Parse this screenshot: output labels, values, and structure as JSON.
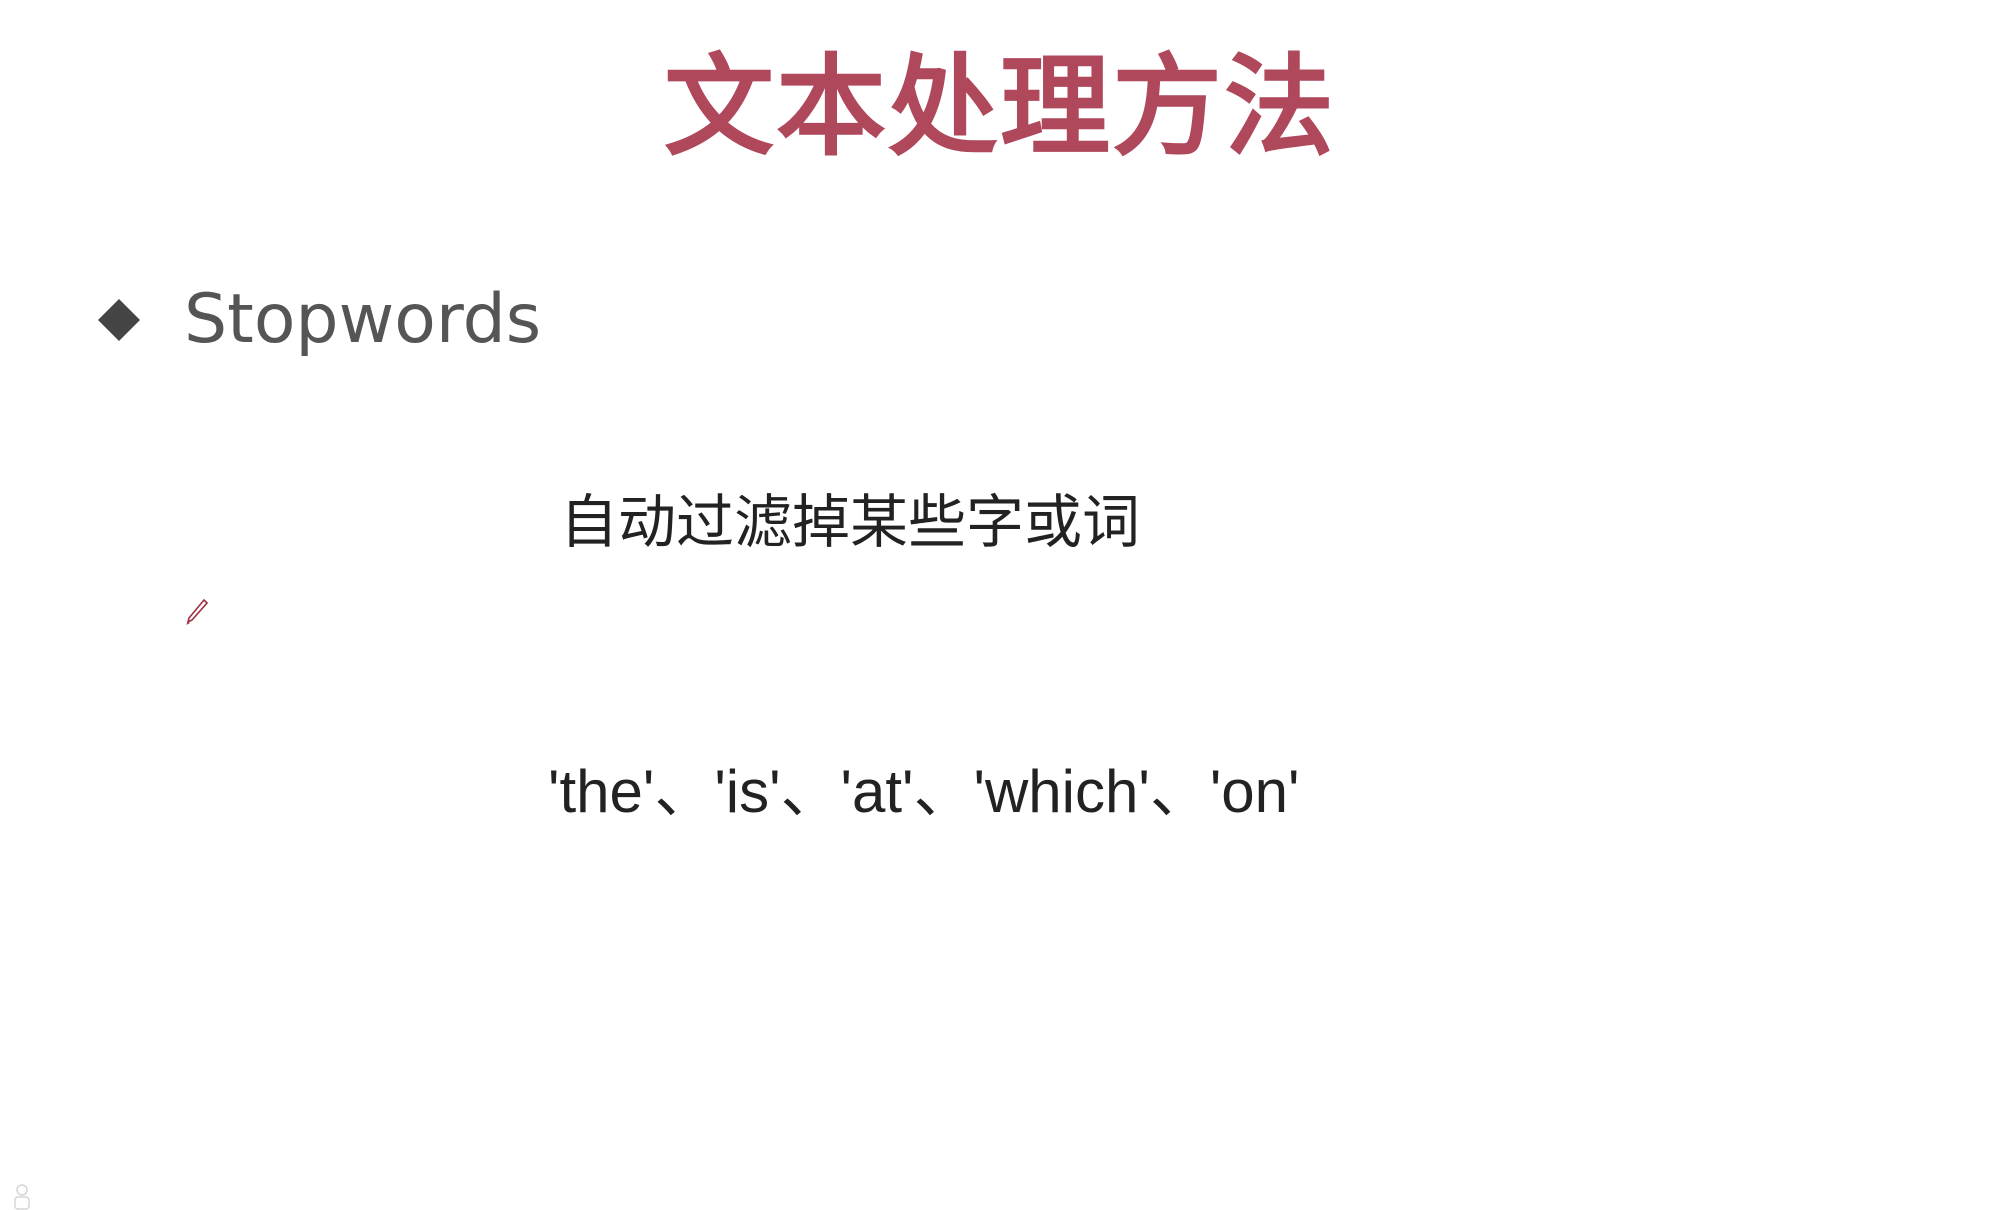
{
  "slide": {
    "title": "文本处理方法",
    "bullet": {
      "icon": "diamond-bullet-icon",
      "label": "Stopwords"
    },
    "description": "自动过滤掉某些字或词",
    "examples": "'the'、'is'、'at'、'which'、'on'"
  },
  "colors": {
    "title": "#b0485c",
    "body_text": "#555555",
    "example_text": "#222222",
    "bullet": "#444444",
    "background": "#ffffff",
    "pen": "#a03040"
  },
  "icons": {
    "pen_cursor": "pen-cursor-icon",
    "corner": "presenter-icon"
  }
}
